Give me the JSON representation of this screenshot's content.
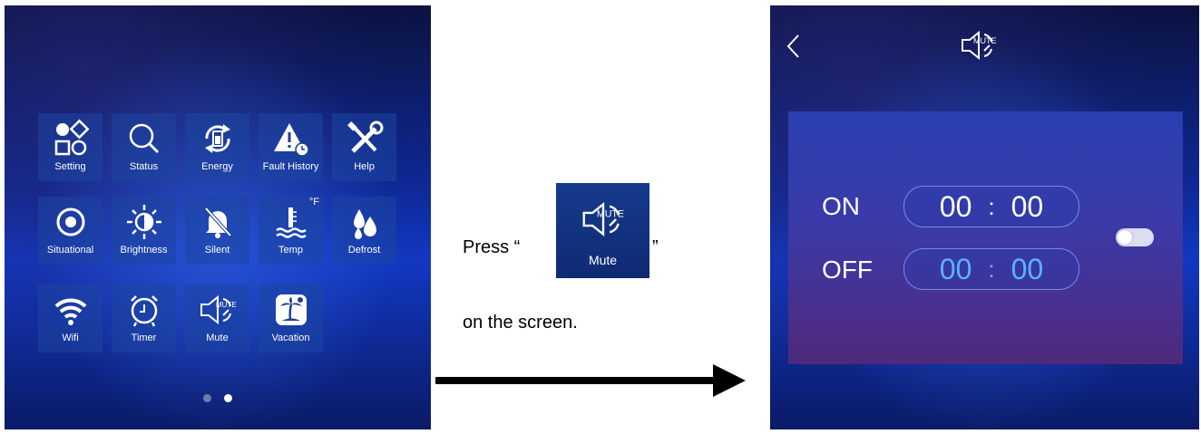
{
  "left_screen": {
    "tiles": [
      {
        "label": "Setting",
        "icon": "setting-icon"
      },
      {
        "label": "Status",
        "icon": "search-icon"
      },
      {
        "label": "Energy",
        "icon": "energy-icon"
      },
      {
        "label": "Fault History",
        "icon": "warning-icon"
      },
      {
        "label": "Help",
        "icon": "tools-icon"
      },
      {
        "label": "Situational",
        "icon": "power-icon"
      },
      {
        "label": "Brightness",
        "icon": "brightness-icon"
      },
      {
        "label": "Silent",
        "icon": "bell-off-icon"
      },
      {
        "label": "Temp",
        "icon": "thermometer-icon",
        "unit": "°F"
      },
      {
        "label": "Defrost",
        "icon": "droplets-icon"
      },
      {
        "label": "Wifi",
        "icon": "wifi-icon"
      },
      {
        "label": "Timer",
        "icon": "alarm-clock-icon"
      },
      {
        "label": "Mute",
        "icon": "mute-icon"
      },
      {
        "label": "Vacation",
        "icon": "palm-tree-icon"
      }
    ],
    "mute_icon_text": "MUTE",
    "page_dots": {
      "count": 2,
      "active": 2
    }
  },
  "instruction": {
    "press_prefix": "Press “",
    "press_suffix": "”",
    "button_label": "Mute",
    "button_icon_text": "MUTE",
    "line2": "on the screen."
  },
  "right_screen": {
    "header_icon": "mute-icon",
    "header_icon_text": "MUTE",
    "on_label": "ON",
    "off_label": "OFF",
    "on_time": {
      "hours": "00",
      "sep": ":",
      "minutes": "00"
    },
    "off_time": {
      "hours": "00",
      "sep": ":",
      "minutes": "00"
    },
    "toggle_state": "off",
    "colors": {
      "on_time": "#ffffff",
      "off_time": "#5ab2ff"
    }
  }
}
